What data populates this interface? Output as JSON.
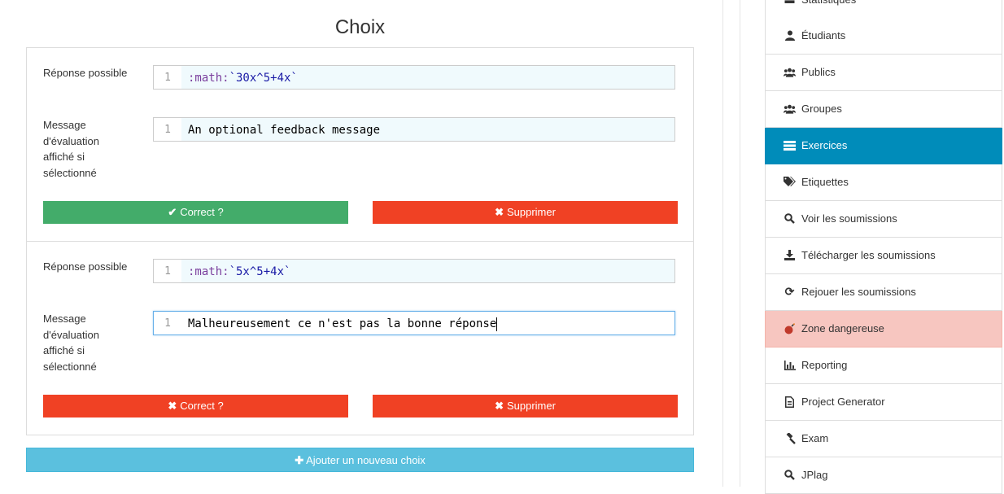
{
  "choices": {
    "title": "Choix",
    "items": [
      {
        "answer_label": "Réponse possible",
        "answer_line": "1",
        "answer_kw": ":math:",
        "answer_value": "`30x^5+4x`",
        "feedback_label": "Message d'évaluation affiché si sélectionné",
        "feedback_line": "1",
        "feedback_value": "An optional feedback message",
        "correct_label": "Correct ?",
        "correct_icon": "check-icon",
        "correct_state": "correct",
        "delete_label": "Supprimer",
        "delete_icon": "times-icon"
      },
      {
        "answer_label": "Réponse possible",
        "answer_line": "1",
        "answer_kw": ":math:",
        "answer_value": "`5x^5+4x`",
        "feedback_label": "Message d'évaluation affiché si sélectionné",
        "feedback_line": "1",
        "feedback_value": "Malheureusement ce n'est pas la bonne réponse",
        "correct_label": "Correct ?",
        "correct_icon": "times-icon",
        "correct_state": "incorrect",
        "delete_label": "Supprimer",
        "delete_icon": "times-icon"
      }
    ],
    "add_label": "Ajouter un nouveau choix",
    "add_icon": "plus-icon"
  },
  "sidebar": {
    "items": [
      {
        "label": "Statistiques",
        "icon": "bar-chart-icon",
        "state": "normal"
      },
      {
        "label": "Étudiants",
        "icon": "user-icon",
        "state": "normal"
      },
      {
        "label": "Publics",
        "icon": "users-icon",
        "state": "normal"
      },
      {
        "label": "Groupes",
        "icon": "users-icon",
        "state": "normal"
      },
      {
        "label": "Exercices",
        "icon": "tasks-icon",
        "state": "active"
      },
      {
        "label": "Etiquettes",
        "icon": "tags-icon",
        "state": "normal"
      },
      {
        "label": "Voir les soumissions",
        "icon": "search-icon",
        "state": "normal"
      },
      {
        "label": "Télécharger les soumissions",
        "icon": "download-icon",
        "state": "normal"
      },
      {
        "label": "Rejouer les soumissions",
        "icon": "refresh-icon",
        "state": "normal"
      },
      {
        "label": "Zone dangereuse",
        "icon": "bomb-icon",
        "state": "danger"
      },
      {
        "label": "Reporting",
        "icon": "bar-chart-icon",
        "state": "normal"
      },
      {
        "label": "Project Generator",
        "icon": "file-code-icon",
        "state": "normal"
      },
      {
        "label": "Exam",
        "icon": "gavel-icon",
        "state": "normal"
      },
      {
        "label": "JPlag",
        "icon": "search-icon",
        "state": "normal"
      }
    ]
  },
  "colors": {
    "green": "#43ac6a",
    "red": "#f04124",
    "info": "#5bc0de",
    "active": "#008cba",
    "danger_bg": "#f7c6c0"
  }
}
